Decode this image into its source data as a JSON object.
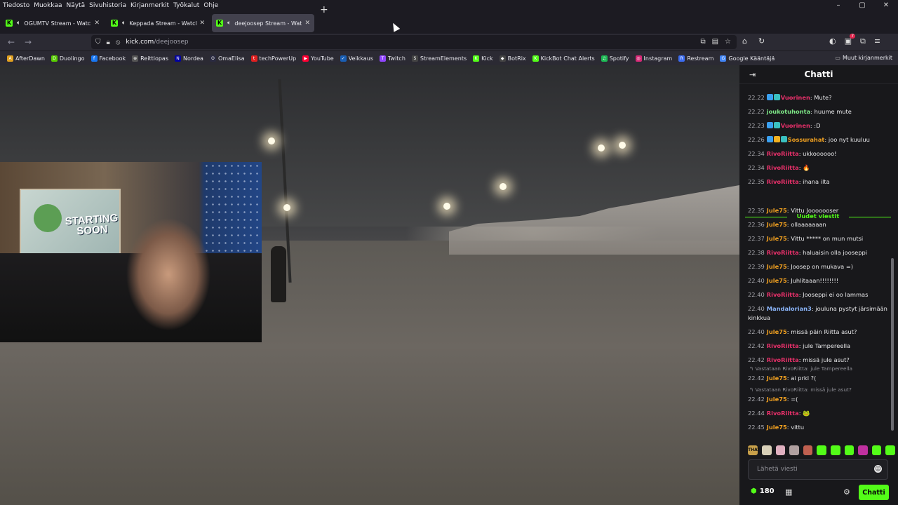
{
  "menubar": {
    "items": [
      "Tiedosto",
      "Muokkaa",
      "Näytä",
      "Sivuhistoria",
      "Kirjanmerkit",
      "Työkalut",
      "Ohje"
    ]
  },
  "tabs": [
    {
      "title": "OGUMTV Stream - Watch Live on Kick",
      "active": false
    },
    {
      "title": "Keppada Stream - Watch Live on Kick",
      "active": false
    },
    {
      "title": "deejoosep Stream - Watch Live on Kick",
      "active": true
    }
  ],
  "url": {
    "domain": "kick.com",
    "path": "/deejoosep"
  },
  "bookmarks": [
    {
      "label": "AfterDawn",
      "color": "#e0a020",
      "icon": "A"
    },
    {
      "label": "Duolingo",
      "color": "#58cc02",
      "icon": "D"
    },
    {
      "label": "Facebook",
      "color": "#1877f2",
      "icon": "f"
    },
    {
      "label": "Reittiopas",
      "color": "#555555",
      "icon": "⊕"
    },
    {
      "label": "Nordea",
      "color": "#0000a0",
      "icon": "N"
    },
    {
      "label": "OmaElisa",
      "color": "#2a2a40",
      "icon": "O"
    },
    {
      "label": "techPowerUp",
      "color": "#e02020",
      "icon": "t"
    },
    {
      "label": "YouTube",
      "color": "#ff0033",
      "icon": "▶"
    },
    {
      "label": "Veikkaus",
      "color": "#1a5fb4",
      "icon": "✓"
    },
    {
      "label": "Twitch",
      "color": "#9146ff",
      "icon": "T"
    },
    {
      "label": "StreamElements",
      "color": "#444444",
      "icon": "S"
    },
    {
      "label": "Kick",
      "color": "#53fc18",
      "icon": "K"
    },
    {
      "label": "BotRix",
      "color": "#444444",
      "icon": "◆"
    },
    {
      "label": "KickBot Chat Alerts",
      "color": "#53fc18",
      "icon": "K"
    },
    {
      "label": "Spotify",
      "color": "#1db954",
      "icon": "♫"
    },
    {
      "label": "Instagram",
      "color": "#d62976",
      "icon": "◎"
    },
    {
      "label": "Restream",
      "color": "#3c6df0",
      "icon": "R"
    },
    {
      "label": "Google Kääntäjä",
      "color": "#4285f4",
      "icon": "G"
    }
  ],
  "other_bookmarks": "Muut kirjanmerkit",
  "webcam": {
    "poster_text": "STARTING SOON"
  },
  "chat": {
    "title": "Chatti",
    "new_messages_label": "Uudet viestit",
    "messages": [
      {
        "time": "22.22",
        "user": "Vuorinen",
        "color": "#e8306a",
        "badges": [
          "#3aa0f0",
          "#3ac0c0"
        ],
        "text": ": Mute?",
        "reply": ""
      },
      {
        "time": "22.22",
        "user": "joukotuhonta",
        "color": "#7ee787",
        "badges": [],
        "text": ": huume mute",
        "reply": ""
      },
      {
        "time": "22.23",
        "user": "Vuorinen",
        "color": "#e8306a",
        "badges": [
          "#3aa0f0",
          "#3ac0c0"
        ],
        "text": ": :D",
        "reply": ""
      },
      {
        "time": "22.26",
        "user": "Sossurahat",
        "color": "#f0a020",
        "badges": [
          "#3aa0f0",
          "#f0b020",
          "#3ac0c0"
        ],
        "text": ": joo nyt kuuluu",
        "reply": ""
      },
      {
        "time": "22.34",
        "user": "RivoRiitta",
        "color": "#e8306a",
        "badges": [],
        "text": ": ukkoooooo!",
        "reply": ""
      },
      {
        "time": "22.34",
        "user": "RivoRiitta",
        "color": "#e8306a",
        "badges": [],
        "text": ": 🔥",
        "reply": ""
      },
      {
        "time": "22.35",
        "user": "RivoRiitta",
        "color": "#e8306a",
        "badges": [],
        "text": ": ihana ilta",
        "reply": ""
      },
      {
        "time": "22.35",
        "user": "Jule75",
        "color": "#f0a020",
        "badges": [],
        "text": ": Vittu Jooooooser",
        "reply": ""
      },
      {
        "time": "22.36",
        "user": "Jule75",
        "color": "#f0a020",
        "badges": [],
        "text": ": ollaaaaaaan",
        "reply": ""
      },
      {
        "time": "22.37",
        "user": "Jule75",
        "color": "#f0a020",
        "badges": [],
        "text": ": Vittu ***** on mun mutsi",
        "reply": ""
      },
      {
        "time": "22.38",
        "user": "RivoRiitta",
        "color": "#e8306a",
        "badges": [],
        "text": ": haluaisin olla jooseppi",
        "reply": ""
      },
      {
        "time": "22.39",
        "user": "Jule75",
        "color": "#f0a020",
        "badges": [],
        "text": ": Joosep on mukava =)",
        "reply": ""
      },
      {
        "time": "22.40",
        "user": "Jule75",
        "color": "#f0a020",
        "badges": [],
        "text": ": Juhlitaaan!!!!!!!!",
        "reply": ""
      },
      {
        "time": "22.40",
        "user": "RivoRiitta",
        "color": "#e8306a",
        "badges": [],
        "text": ": Jooseppi ei oo lammas",
        "reply": ""
      },
      {
        "time": "22.40",
        "user": "Mandalorian3",
        "color": "#8ab4f8",
        "badges": [],
        "text": ": jouluna pystyt järsimään kinkkua",
        "reply": ""
      },
      {
        "time": "22.40",
        "user": "Jule75",
        "color": "#f0a020",
        "badges": [],
        "text": ": missä päin Riitta asut?",
        "reply": ""
      },
      {
        "time": "22.42",
        "user": "RivoRiitta",
        "color": "#e8306a",
        "badges": [],
        "text": ": jule Tampereella",
        "reply": ""
      },
      {
        "time": "22.42",
        "user": "RivoRiitta",
        "color": "#e8306a",
        "badges": [],
        "text": ": missä jule asut?",
        "reply": ""
      },
      {
        "time": "22.42",
        "user": "Jule75",
        "color": "#f0a020",
        "badges": [],
        "text": ": ai prkl ?(",
        "reply": "Vastataan RivoRiitta: jule Tampereella"
      },
      {
        "time": "22.42",
        "user": "Jule75",
        "color": "#f0a020",
        "badges": [],
        "text": ": =(",
        "reply": "Vastataan RivoRiitta: missä jule asut?"
      },
      {
        "time": "22.44",
        "user": "RivoRiitta",
        "color": "#e8306a",
        "badges": [],
        "text": ": 🐸",
        "reply": ""
      },
      {
        "time": "22.45",
        "user": "Jule75",
        "color": "#f0a020",
        "badges": [],
        "text": ": vittu",
        "reply": ""
      }
    ],
    "emotes": [
      {
        "name": "emote-thatsit",
        "color": "#c8a04a",
        "label": "THAT"
      },
      {
        "name": "emote-1",
        "color": "#d8d0b8",
        "label": ""
      },
      {
        "name": "emote-2",
        "color": "#e0b0c0",
        "label": ""
      },
      {
        "name": "emote-3",
        "color": "#b0a0a0",
        "label": ""
      },
      {
        "name": "emote-4",
        "color": "#c06050",
        "label": ""
      },
      {
        "name": "emote-5",
        "color": "#53fc18",
        "label": ""
      },
      {
        "name": "emote-6",
        "color": "#53fc18",
        "label": ""
      },
      {
        "name": "emote-7",
        "color": "#53fc18",
        "label": ""
      },
      {
        "name": "emote-8",
        "color": "#c030a0",
        "label": ""
      },
      {
        "name": "emote-9",
        "color": "#53fc18",
        "label": ""
      },
      {
        "name": "emote-10",
        "color": "#53fc18",
        "label": ""
      }
    ],
    "input_placeholder": "Lähetä viesti",
    "points": "180",
    "send_label": "Chatti"
  },
  "colors": {
    "accent": "#53fc18",
    "chat_bg": "#18181b",
    "browser_bg": "#1c1b22"
  }
}
